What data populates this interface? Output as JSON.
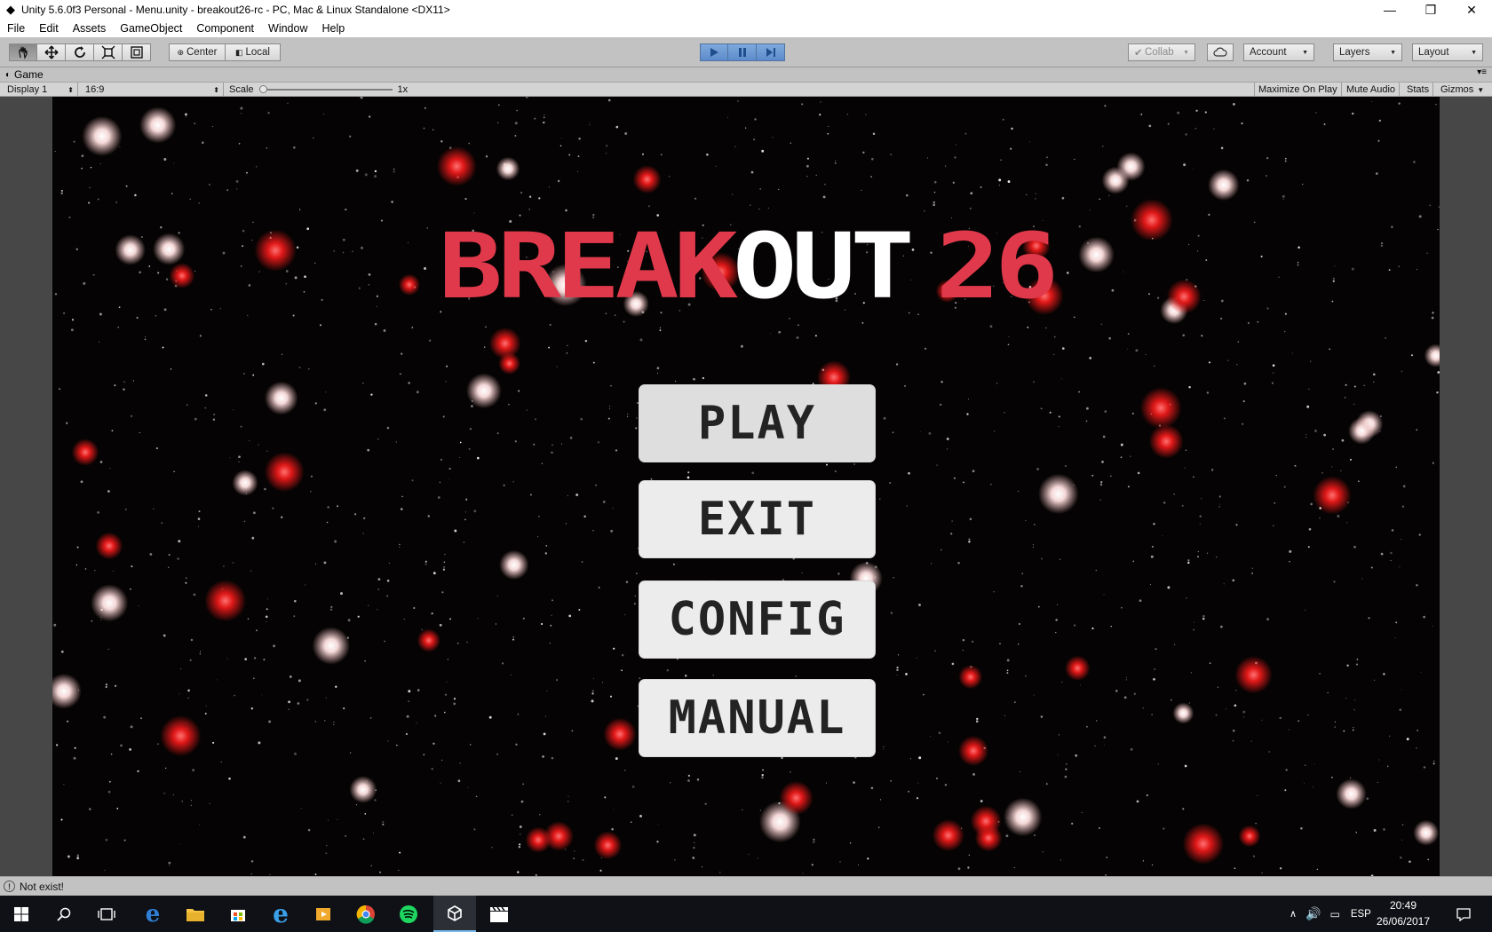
{
  "window": {
    "title": "Unity 5.6.0f3 Personal - Menu.unity - breakout26-rc - PC, Mac & Linux Standalone <DX11>",
    "minimize": "—",
    "maximize": "❐",
    "close": "✕"
  },
  "menubar": [
    "File",
    "Edit",
    "Assets",
    "GameObject",
    "Component",
    "Window",
    "Help"
  ],
  "toolbar": {
    "pivot_label": "Center",
    "space_label": "Local",
    "collab_label": "Collab",
    "account_label": "Account",
    "layers_label": "Layers",
    "layout_label": "Layout"
  },
  "game_tab": {
    "label": "Game"
  },
  "game_toolbar": {
    "display": "Display 1",
    "aspect": "16:9",
    "scale_label": "Scale",
    "scale_value": "1x",
    "maximize": "Maximize On Play",
    "mute": "Mute Audio",
    "stats": "Stats",
    "gizmos": "Gizmos"
  },
  "game": {
    "title_part1": "BREAK",
    "title_part2": "OUT",
    "title_part3": "26",
    "buttons": {
      "play": "PLAY",
      "exit": "EXIT",
      "config": "CONFIG",
      "manual": "MANUAL"
    },
    "colors": {
      "title_red": "#e0394b",
      "title_white": "#ffffff",
      "button_bg": "#ececec",
      "button_text": "#232323"
    }
  },
  "status": {
    "message": "Not exist!"
  },
  "taskbar": {
    "language": "ESP",
    "time": "20:49",
    "date": "26/06/2017"
  }
}
